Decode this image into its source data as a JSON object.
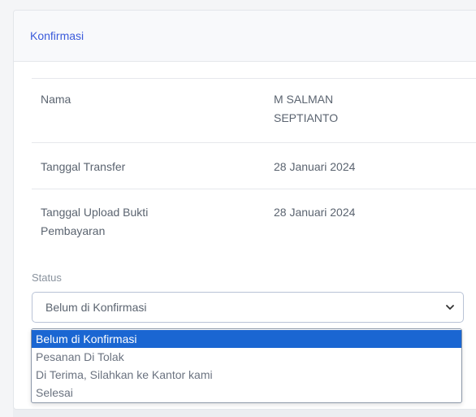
{
  "card": {
    "title": "Konfirmasi"
  },
  "details": [
    {
      "label": "Nama",
      "value": "M SALMAN\nSEPTIANTO"
    },
    {
      "label": "Tanggal Transfer",
      "value": "28 Januari 2024"
    },
    {
      "label": "Tanggal Upload Bukti\nPembayaran",
      "value": "28 Januari 2024"
    }
  ],
  "status": {
    "label": "Status",
    "selected": "Belum di Konfirmasi",
    "options": [
      "Belum di Konfirmasi",
      "Pesanan Di Tolak",
      "Di Terima, Silahkan ke Kantor kami",
      "Selesai"
    ]
  },
  "colors": {
    "accent": "#3b5bdb",
    "option_highlight": "#1a66d2"
  },
  "icons": {
    "select_arrow": "chevron-down-icon"
  }
}
